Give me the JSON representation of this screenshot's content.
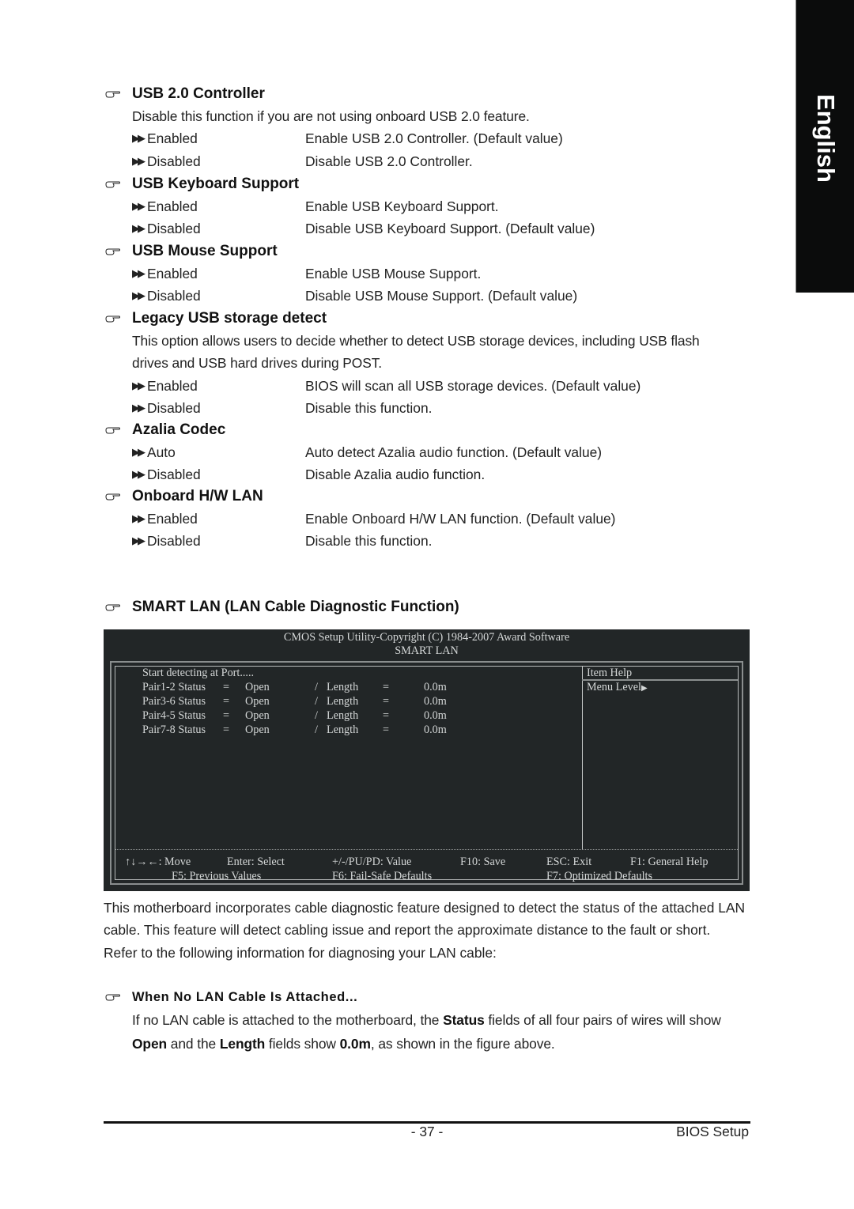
{
  "side_tab": {
    "label": "English"
  },
  "sections": [
    {
      "title": "USB 2.0 Controller",
      "description": [
        "Disable this function if you are not using onboard USB 2.0 feature."
      ],
      "options": [
        {
          "value": "Enabled",
          "desc": "Enable USB 2.0 Controller. (Default value)"
        },
        {
          "value": "Disabled",
          "desc": "Disable USB 2.0 Controller."
        }
      ]
    },
    {
      "title": "USB Keyboard Support",
      "description": [],
      "options": [
        {
          "value": "Enabled",
          "desc": "Enable USB Keyboard Support."
        },
        {
          "value": "Disabled",
          "desc": "Disable USB Keyboard Support. (Default value)"
        }
      ]
    },
    {
      "title": "USB Mouse Support",
      "description": [],
      "options": [
        {
          "value": "Enabled",
          "desc": "Enable USB Mouse Support."
        },
        {
          "value": "Disabled",
          "desc": "Disable USB Mouse Support. (Default value)"
        }
      ]
    },
    {
      "title": "Legacy USB storage detect",
      "description": [
        "This option allows users to decide whether to detect USB storage devices, including USB flash",
        "drives and USB hard drives during POST."
      ],
      "options": [
        {
          "value": "Enabled",
          "desc": "BIOS will scan all USB storage devices. (Default value)"
        },
        {
          "value": "Disabled",
          "desc": "Disable this function."
        }
      ]
    },
    {
      "title": "Azalia Codec",
      "description": [],
      "options": [
        {
          "value": "Auto",
          "desc": "Auto detect Azalia audio function. (Default value)"
        },
        {
          "value": "Disabled",
          "desc": "Disable Azalia audio function."
        }
      ]
    },
    {
      "title": "Onboard H/W LAN",
      "description": [],
      "options": [
        {
          "value": "Enabled",
          "desc": "Enable Onboard H/W LAN function. (Default value)"
        },
        {
          "value": "Disabled",
          "desc": "Disable this function."
        }
      ]
    }
  ],
  "smart_lan_heading": "SMART LAN (LAN Cable Diagnostic Function)",
  "bios": {
    "title_line1": "CMOS Setup Utility-Copyright (C) 1984-2007 Award Software",
    "title_line2": "SMART LAN",
    "start_text": "Start detecting at Port.....",
    "pairs": [
      {
        "pair": "Pair1-2 Status",
        "eq1": "=",
        "status": "Open",
        "sep": "/",
        "length_label": "Length",
        "eq2": "=",
        "length": "0.0m"
      },
      {
        "pair": "Pair3-6 Status",
        "eq1": "=",
        "status": "Open",
        "sep": "/",
        "length_label": "Length",
        "eq2": "=",
        "length": "0.0m"
      },
      {
        "pair": "Pair4-5 Status",
        "eq1": "=",
        "status": "Open",
        "sep": "/",
        "length_label": "Length",
        "eq2": "=",
        "length": "0.0m"
      },
      {
        "pair": "Pair7-8 Status",
        "eq1": "=",
        "status": "Open",
        "sep": "/",
        "length_label": "Length",
        "eq2": "=",
        "length": "0.0m"
      }
    ],
    "item_help": "Item Help",
    "menu_level": "Menu Level",
    "footer_row1": {
      "move": "↑↓→←: Move",
      "select": "Enter: Select",
      "value": "+/-/PU/PD: Value",
      "save": "F10: Save",
      "exit": "ESC: Exit",
      "help": "F1: General Help"
    },
    "footer_row2": {
      "previous": "F5: Previous Values",
      "failsafe": "F6: Fail-Safe Defaults",
      "optimized": "F7: Optimized Defaults"
    }
  },
  "intro_paragraph": [
    "This motherboard incorporates cable diagnostic feature designed to detect the status of the attached LAN",
    "cable.  This feature will detect cabling issue and report the approximate distance to the fault or short.",
    "Refer to the following information for diagnosing your LAN cable:"
  ],
  "no_cable": {
    "heading": "When No LAN Cable Is Attached...",
    "line1_pre": "If no LAN cable is attached to the motherboard, the ",
    "line1_bold": "Status",
    "line1_post": " fields of all four pairs of wires will show",
    "line2_bold1": "Open",
    "line2_mid1": " and the ",
    "line2_bold2": "Length",
    "line2_mid2": " fields show ",
    "line2_bold3": "0.0m",
    "line2_post": ",  as shown in the figure above."
  },
  "footer": {
    "page_number": "- 37 -",
    "section_label": "BIOS Setup"
  }
}
